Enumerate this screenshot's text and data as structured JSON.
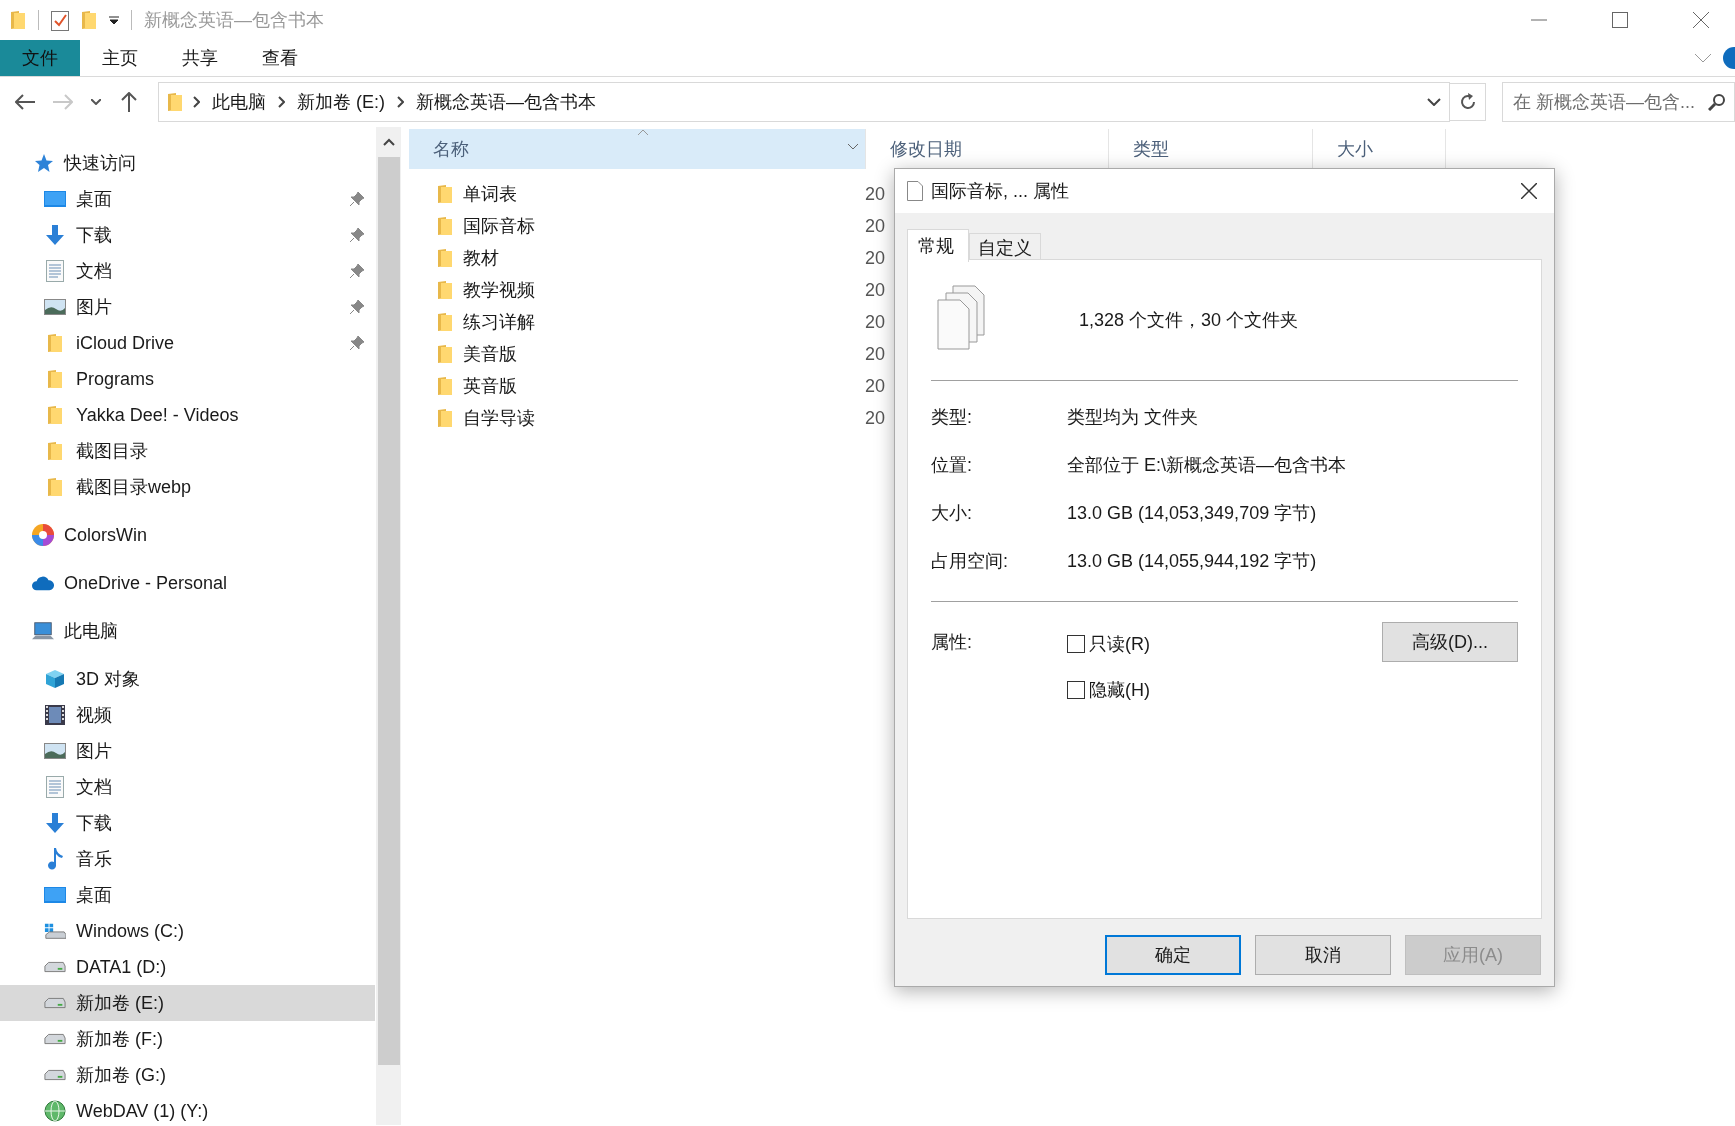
{
  "window": {
    "title": "新概念英语—包含书本"
  },
  "ribbon_tabs": [
    {
      "label": "文件",
      "kind": "file"
    },
    {
      "label": "主页",
      "kind": "tab"
    },
    {
      "label": "共享",
      "kind": "tab"
    },
    {
      "label": "查看",
      "kind": "tab"
    }
  ],
  "nav_buttons": [
    {
      "kind": "back",
      "disabled": false
    },
    {
      "kind": "forward",
      "disabled": true
    },
    {
      "kind": "recent",
      "disabled": false
    },
    {
      "kind": "up",
      "disabled": false
    }
  ],
  "address": {
    "breadcrumbs": [
      "此电脑",
      "新加卷 (E:)",
      "新概念英语—包含书本"
    ]
  },
  "search": {
    "placeholder": "在 新概念英语—包含..."
  },
  "sidebar": {
    "items": [
      {
        "label": "快速访问",
        "kind": "quick-access",
        "selected": false,
        "children": [
          {
            "label": "桌面",
            "kind": "desktop",
            "selected": false,
            "pinned": true
          },
          {
            "label": "下载",
            "kind": "download",
            "selected": false,
            "pinned": true
          },
          {
            "label": "文档",
            "kind": "documents",
            "selected": false,
            "pinned": true
          },
          {
            "label": "图片",
            "kind": "pictures",
            "selected": false,
            "pinned": true
          },
          {
            "label": "iCloud Drive",
            "kind": "folder",
            "selected": false,
            "pinned": true
          },
          {
            "label": "Programs",
            "kind": "folder",
            "selected": false,
            "pinned": false
          },
          {
            "label": "Yakka Dee! - Videos",
            "kind": "folder",
            "selected": false,
            "pinned": false
          },
          {
            "label": "截图目录",
            "kind": "folder",
            "selected": false,
            "pinned": false
          },
          {
            "label": "截图目录webp",
            "kind": "folder",
            "selected": false,
            "pinned": false
          }
        ]
      },
      {
        "label": "ColorsWin",
        "kind": "colors",
        "selected": false
      },
      {
        "label": "OneDrive - Personal",
        "kind": "cloud",
        "selected": false
      },
      {
        "label": "此电脑",
        "kind": "pc",
        "selected": false,
        "children": [
          {
            "label": "3D 对象",
            "kind": "cube",
            "selected": false
          },
          {
            "label": "视频",
            "kind": "video",
            "selected": false
          },
          {
            "label": "图片",
            "kind": "pictures",
            "selected": false
          },
          {
            "label": "文档",
            "kind": "documents",
            "selected": false
          },
          {
            "label": "下载",
            "kind": "download",
            "selected": false
          },
          {
            "label": "音乐",
            "kind": "music",
            "selected": false
          },
          {
            "label": "桌面",
            "kind": "desktop",
            "selected": false
          },
          {
            "label": "Windows (C:)",
            "kind": "windows-drive",
            "selected": false
          },
          {
            "label": "DATA1 (D:)",
            "kind": "drive",
            "selected": false
          },
          {
            "label": "新加卷 (E:)",
            "kind": "drive",
            "selected": true
          },
          {
            "label": "新加卷 (F:)",
            "kind": "drive",
            "selected": false
          },
          {
            "label": "新加卷 (G:)",
            "kind": "drive",
            "selected": false
          },
          {
            "label": "WebDAV (1) (Y:)",
            "kind": "network",
            "selected": false
          }
        ]
      }
    ]
  },
  "file_list": {
    "columns": [
      {
        "label": "名称",
        "sorted": true
      },
      {
        "label": "修改日期",
        "sorted": false
      },
      {
        "label": "类型",
        "sorted": false
      },
      {
        "label": "大小",
        "sorted": false
      }
    ],
    "rows": [
      {
        "name": "单词表",
        "modified": "20"
      },
      {
        "name": "国际音标",
        "modified": "20"
      },
      {
        "name": "教材",
        "modified": "20"
      },
      {
        "name": "教学视频",
        "modified": "20"
      },
      {
        "name": "练习详解",
        "modified": "20"
      },
      {
        "name": "美音版",
        "modified": "20"
      },
      {
        "name": "英音版",
        "modified": "20"
      },
      {
        "name": "自学导读",
        "modified": "20"
      }
    ]
  },
  "dialog": {
    "title": "国际音标, ... 属性",
    "tabs": [
      {
        "label": "常规",
        "selected": true
      },
      {
        "label": "自定义",
        "selected": false
      }
    ],
    "summary": "1,328 个文件，30 个文件夹",
    "details": [
      {
        "label": "类型:",
        "value": "类型均为 文件夹"
      },
      {
        "label": "位置:",
        "value": "全部位于 E:\\新概念英语—包含书本"
      },
      {
        "label": "大小:",
        "value": "13.0 GB (14,053,349,709 字节)"
      },
      {
        "label": "占用空间:",
        "value": "13.0 GB (14,055,944,192 字节)"
      }
    ],
    "attributes_label": "属性:",
    "attributes": [
      {
        "label": "只读(R)",
        "checked": false
      },
      {
        "label": "隐藏(H)",
        "checked": false
      }
    ],
    "advanced_button": "高级(D)...",
    "buttons": [
      {
        "label": "确定",
        "default": true,
        "disabled": false
      },
      {
        "label": "取消",
        "default": false,
        "disabled": false
      },
      {
        "label": "应用(A)",
        "default": false,
        "disabled": true
      }
    ]
  }
}
